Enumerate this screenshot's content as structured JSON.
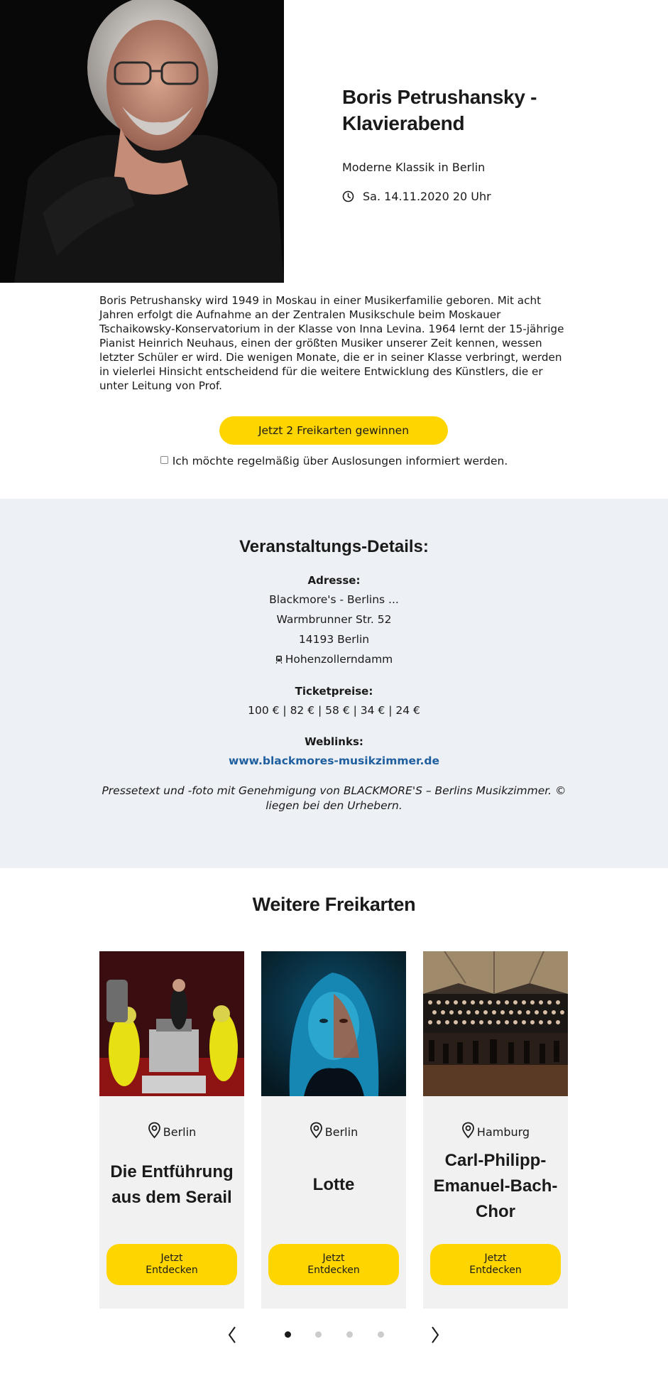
{
  "hero": {
    "title_line1": "Boris Petrushansky -",
    "title_line2": "Klavierabend",
    "subtitle": "Moderne Klassik in Berlin",
    "date": "Sa. 14.11.2020 20 Uhr",
    "photo_icon": "portrait-photo"
  },
  "description": "Boris Petrushansky wird 1949 in Moskau in einer Musikerfamilie geboren. Mit acht Jahren erfolgt die Aufnahme an der Zentralen Musikschule beim Moskauer Tschaikowsky-Konservatorium in der Klasse von Inna Levina. 1964 lernt der 15-jährige Pianist Heinrich Neuhaus, einen der größten Musiker unserer Zeit kennen, wessen letzter Schüler er wird. Die wenigen Monate, die er in seiner Klasse verbringt, werden in vielerlei Hinsicht entscheidend für die weitere Entwicklung des Künstlers, die er unter Leitung von Prof.",
  "cta": {
    "label": "Jetzt 2 Freikarten gewinnen"
  },
  "optin": {
    "label": "Ich möchte regelmäßig über Auslosungen informiert werden.",
    "checked": false
  },
  "details": {
    "title": "Veranstaltungs-Details:",
    "address_label": "Adresse:",
    "venue": "Blackmore's - Berlins ...",
    "street": "Warmbrunner Str. 52",
    "city": "14193 Berlin",
    "transit": "Hohenzollerndamm",
    "prices_label": "Ticketpreise:",
    "prices": "100 € | 82 € | 58 € | 34 € | 24 €",
    "weblinks_label": "Weblinks:",
    "weblink": "www.blackmores-musikzimmer.de",
    "note_line1": "Pressetext und -foto mit Genehmigung von BLACKMORE'S – Berlins Musikzimmer. ©",
    "note_line2": "liegen bei den Urhebern."
  },
  "more": {
    "title": "Weitere Freikarten",
    "cards": [
      {
        "location": "Berlin",
        "title_lines": [
          "Die Entführung",
          "aus dem Serail"
        ],
        "button_line1": "Jetzt",
        "button_line2": "Entdecken"
      },
      {
        "location": "Berlin",
        "title_lines": [
          "Lotte"
        ],
        "button_line1": "Jetzt",
        "button_line2": "Entdecken"
      },
      {
        "location": "Hamburg",
        "title_lines": [
          "Carl-Philipp-",
          "Emanuel-Bach-",
          "Chor"
        ],
        "button_line1": "Jetzt",
        "button_line2": "Entdecken"
      }
    ]
  },
  "carousel": {
    "prev_icon": "chevron-left-icon",
    "next_icon": "chevron-right-icon",
    "dots": 4,
    "active_dot": 0
  },
  "colors": {
    "accent": "#ffd500",
    "details_bg": "#edf0f4",
    "card_bg": "#f1f1f1",
    "link": "#1f5fa0"
  }
}
